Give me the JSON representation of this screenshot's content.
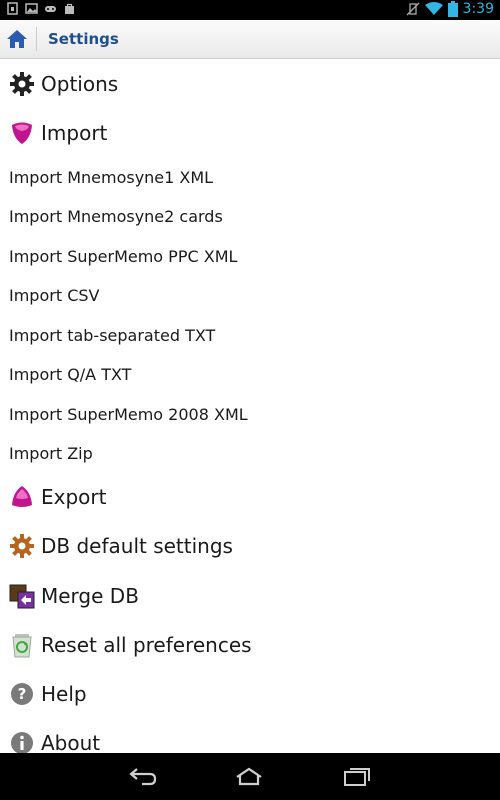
{
  "status_bar": {
    "time": "3:39"
  },
  "action_bar": {
    "title": "Settings"
  },
  "list": {
    "options": "Options",
    "import": "Import",
    "import_items": [
      "Import Mnemosyne1 XML",
      "Import Mnemosyne2 cards",
      "Import SuperMemo PPC XML",
      "Import CSV",
      "Import tab-separated TXT",
      "Import Q/A TXT",
      "Import SuperMemo 2008 XML",
      "Import Zip"
    ],
    "export": "Export",
    "db_default_settings": "DB default settings",
    "merge_db": "Merge DB",
    "reset_all_preferences": "Reset all preferences",
    "help": "Help",
    "about": "About"
  },
  "colors": {
    "accent": "#33b5e5",
    "title": "#1f4e8f",
    "magenta": "#c0158f",
    "bronze": "#b5651d"
  },
  "icons": [
    "gear-icon",
    "import-icon",
    "export-icon",
    "db-settings-icon",
    "merge-db-icon",
    "recycle-icon",
    "help-icon",
    "info-icon"
  ]
}
